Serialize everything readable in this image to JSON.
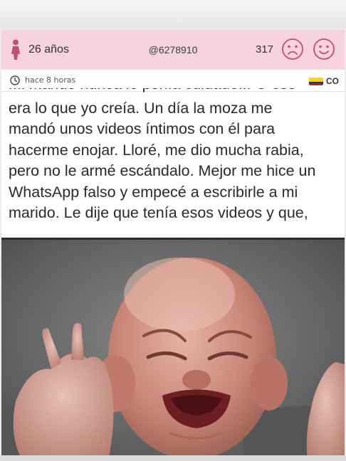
{
  "post": {
    "age": "26 años",
    "username": "@6278910",
    "votes": "317",
    "timestamp": "hace 8 horas",
    "country": "CO",
    "icons": {
      "gender": "female-icon",
      "sad": "sad-face-icon",
      "happy": "happy-face-icon",
      "clock": "clock-icon",
      "flag": "colombia-flag-icon"
    },
    "colors": {
      "header_bg": "#f6d3df",
      "accent": "#c24c78"
    }
  },
  "body": {
    "lines": [
      "Mi marido nunca le ponía cuidado... O eso",
      "era lo que yo creía. Un día la moza me",
      "mandó unos videos íntimos con él para",
      "hacerme enojar. Lloré, me dio mucha rabia,",
      "pero no le armé escándalo. Mejor me hice un",
      "WhatsApp falso y empecé a escribirle a mi",
      "marido. Le dije que tenía esos videos y que,"
    ]
  }
}
